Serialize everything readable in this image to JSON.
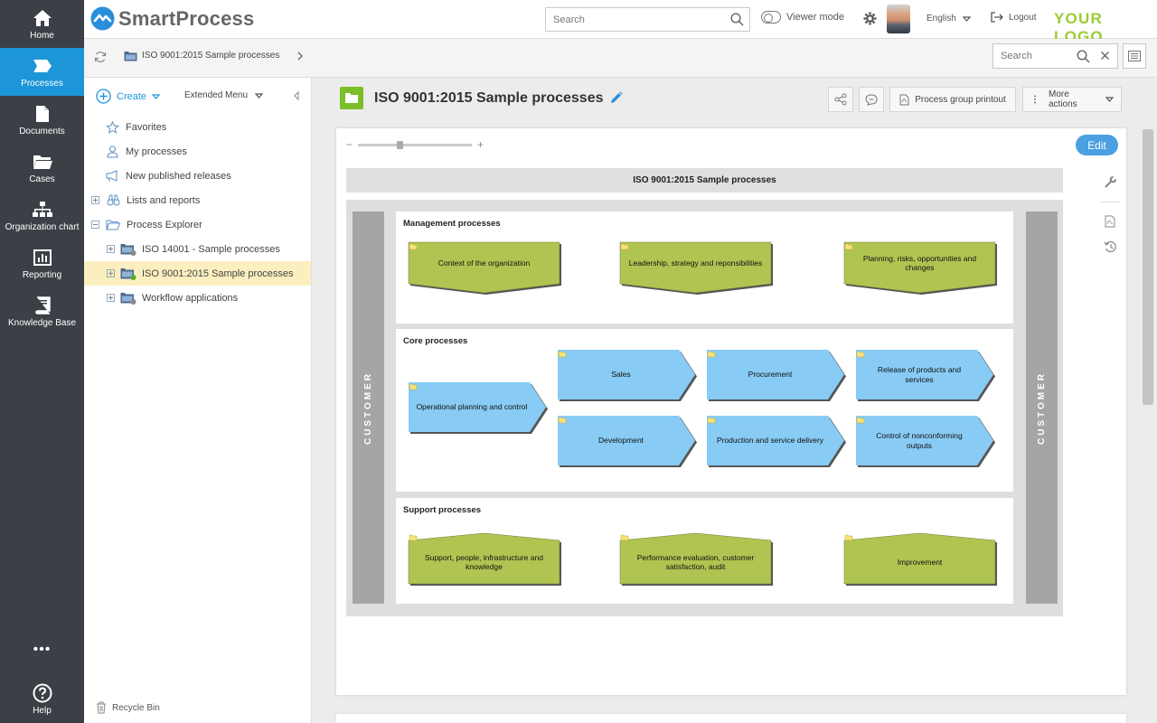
{
  "nav": {
    "items": [
      {
        "label": "Home",
        "icon": "home-icon"
      },
      {
        "label": "Processes",
        "icon": "process-icon"
      },
      {
        "label": "Documents",
        "icon": "document-icon"
      },
      {
        "label": "Cases",
        "icon": "folder-icon"
      },
      {
        "label": "Organization chart",
        "icon": "org-chart-icon"
      },
      {
        "label": "Reporting",
        "icon": "chart-icon"
      },
      {
        "label": "Knowledge Base",
        "icon": "book-icon"
      }
    ],
    "more": "•••",
    "help": "Help",
    "active_color": "#1d96d9"
  },
  "header": {
    "brand": "SmartProcess",
    "search_placeholder": "Search",
    "viewer_mode": "Viewer mode",
    "language": "English",
    "logout": "Logout",
    "logo_text": "YOUR LOGO"
  },
  "breadcrumb": {
    "path": "ISO 9001:2015 Sample processes",
    "search_placeholder": "Search"
  },
  "tree": {
    "create": "Create",
    "extended_menu": "Extended Menu",
    "items": [
      {
        "label": "Favorites",
        "icon": "star-icon"
      },
      {
        "label": "My processes",
        "icon": "user-icon"
      },
      {
        "label": "New published releases",
        "icon": "megaphone-icon"
      },
      {
        "label": "Lists and reports",
        "icon": "binoculars-icon"
      },
      {
        "label": "Process Explorer",
        "icon": "folder-open-icon"
      }
    ],
    "children": [
      {
        "label": "ISO 14001 - Sample processes"
      },
      {
        "label": "ISO 9001:2015 Sample processes"
      },
      {
        "label": "Workflow applications"
      }
    ],
    "recycle_bin": "Recycle Bin"
  },
  "content": {
    "title": "ISO 9001:2015 Sample processes",
    "actions": {
      "printout": "Process group printout",
      "more": "More actions"
    },
    "zoom_minus": "−",
    "zoom_plus": "+",
    "edit": "Edit"
  },
  "diagram": {
    "title": "ISO 9001:2015 Sample processes",
    "customer_label": "CUSTOMER",
    "sections": {
      "management": {
        "title": "Management processes",
        "items": [
          "Context of the organization",
          "Leadership, strategy and reponsibilities",
          "Planning, risks, opportunities and changes"
        ]
      },
      "core": {
        "title": "Core processes",
        "items": [
          "Operational planning and control",
          "Sales",
          "Procurement",
          "Release of products and services",
          "Development",
          "Production and service delivery",
          "Control of nonconforming outputs"
        ]
      },
      "support": {
        "title": "Support processes",
        "items": [
          "Support, people, infrastructure and knowledge",
          "Performance evaluation, customer satisfaction, audit",
          "Improvement"
        ]
      }
    },
    "colors": {
      "green": "#b0c452",
      "blue": "#88cbf4",
      "folder": "#f4e27a"
    }
  }
}
